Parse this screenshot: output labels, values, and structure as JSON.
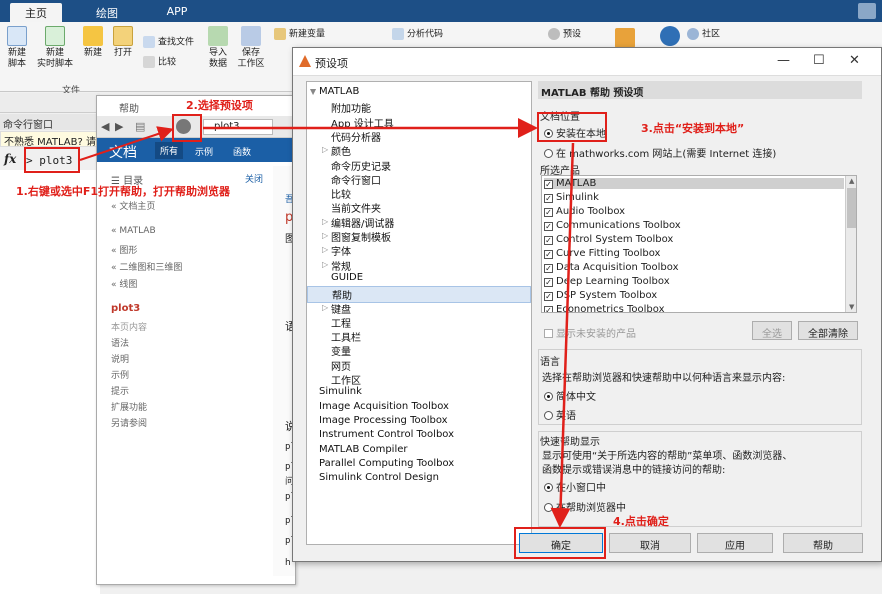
{
  "matlab": {
    "tabs": [
      "主页",
      "绘图",
      "APP"
    ],
    "ribbon": {
      "new_script": "新建\n脚本",
      "new_live_script": "新建\n实时脚本",
      "new": "新建",
      "open": "打开",
      "find_files": "查找文件",
      "compare": "比较",
      "import_data": "导入\n数据",
      "save_workspace": "保存\n工作区",
      "new_variable": "新建变量",
      "analyze_code": "分析代码",
      "preferences": "预设",
      "community": "社区",
      "file_group": "文件"
    },
    "command_window_title": "命令行窗口",
    "notice": "不熟悉 MATLAB? 请",
    "prompt_symbol": "fx",
    "command_text": "> plot3"
  },
  "help": {
    "title": "帮助",
    "url_text": "plot3",
    "doc_label": "文档",
    "tabs": [
      "所有",
      "示例",
      "函数"
    ],
    "toc_label": "目录",
    "close_label": "关闭",
    "sidebar": [
      "« 文档主页",
      "« MATLAB",
      "« 图形",
      "« 二维图和三维图",
      "« 线图",
      "plot3",
      "本页内容",
      "语法",
      "说明",
      "示例",
      "提示",
      "扩展功能",
      "另请参阅"
    ],
    "right_snippets": [
      "吾",
      "p",
      "图",
      "语",
      "说",
      "pl",
      "pl",
      "问",
      "pl",
      "pl",
      "pl",
      "h"
    ]
  },
  "dialog": {
    "title": "预设项",
    "tree": [
      {
        "label": "MATLAB",
        "level": 0,
        "arrow": "down"
      },
      {
        "label": "附加功能",
        "level": 1
      },
      {
        "label": "App 设计工具",
        "level": 1
      },
      {
        "label": "代码分析器",
        "level": 1
      },
      {
        "label": "颜色",
        "level": 1,
        "arrow": "right"
      },
      {
        "label": "命令历史记录",
        "level": 1
      },
      {
        "label": "命令行窗口",
        "level": 1
      },
      {
        "label": "比较",
        "level": 1
      },
      {
        "label": "当前文件夹",
        "level": 1
      },
      {
        "label": "编辑器/调试器",
        "level": 1,
        "arrow": "right"
      },
      {
        "label": "图窗复制模板",
        "level": 1,
        "arrow": "right"
      },
      {
        "label": "字体",
        "level": 1,
        "arrow": "right"
      },
      {
        "label": "常规",
        "level": 1,
        "arrow": "right"
      },
      {
        "label": "GUIDE",
        "level": 1
      },
      {
        "label": "帮助",
        "level": 1,
        "selected": true
      },
      {
        "label": "键盘",
        "level": 1,
        "arrow": "right"
      },
      {
        "label": "工程",
        "level": 1
      },
      {
        "label": "工具栏",
        "level": 1
      },
      {
        "label": "变量",
        "level": 1
      },
      {
        "label": "网页",
        "level": 1
      },
      {
        "label": "工作区",
        "level": 1
      },
      {
        "label": "Simulink",
        "level": 0
      },
      {
        "label": "Image Acquisition Toolbox",
        "level": 0
      },
      {
        "label": "Image Processing Toolbox",
        "level": 0
      },
      {
        "label": "Instrument Control Toolbox",
        "level": 0
      },
      {
        "label": "MATLAB Compiler",
        "level": 0
      },
      {
        "label": "Parallel Computing Toolbox",
        "level": 0
      },
      {
        "label": "Simulink Control Design",
        "level": 0
      }
    ],
    "panel_title": "MATLAB 帮助 预设项",
    "doc_location": {
      "title": "文档位置",
      "options": [
        "安装在本地",
        "在 mathworks.com 网站上(需要 Internet 连接)"
      ],
      "selected": 0
    },
    "products": {
      "title": "所选产品",
      "items": [
        "MATLAB",
        "Simulink",
        "Audio Toolbox",
        "Communications Toolbox",
        "Control System Toolbox",
        "Curve Fitting Toolbox",
        "Data Acquisition Toolbox",
        "Deep Learning Toolbox",
        "DSP System Toolbox",
        "Econometrics Toolbox"
      ],
      "show_uninstalled": "显示未安装的产品",
      "select_all": "全选",
      "clear_all": "全部清除"
    },
    "language": {
      "title": "语言",
      "desc": "选择在帮助浏览器和快速帮助中以何种语言来显示内容:",
      "options": [
        "简体中文",
        "英语"
      ],
      "selected": 0
    },
    "quick_help": {
      "title": "快速帮助显示",
      "desc1": "显示可使用“关于所选内容的帮助”菜单项、函数浏览器、",
      "desc2": "函数提示或错误消息中的链接访问的帮助:",
      "options": [
        "在小窗口中",
        "在帮助浏览器中"
      ],
      "selected": 0
    },
    "buttons": {
      "ok": "确定",
      "cancel": "取消",
      "apply": "应用",
      "help": "帮助"
    }
  },
  "annotations": {
    "step1": "1.右键或选中F1打开帮助，打开帮助浏览器",
    "step2": "2.选择预设项",
    "step3": "3.点击“安装到本地”",
    "step4": "4.点击确定"
  },
  "colors": {
    "accent_red": "#e0201a",
    "matlab_blue": "#1d4f86",
    "doc_blue": "#1b5fa6"
  }
}
